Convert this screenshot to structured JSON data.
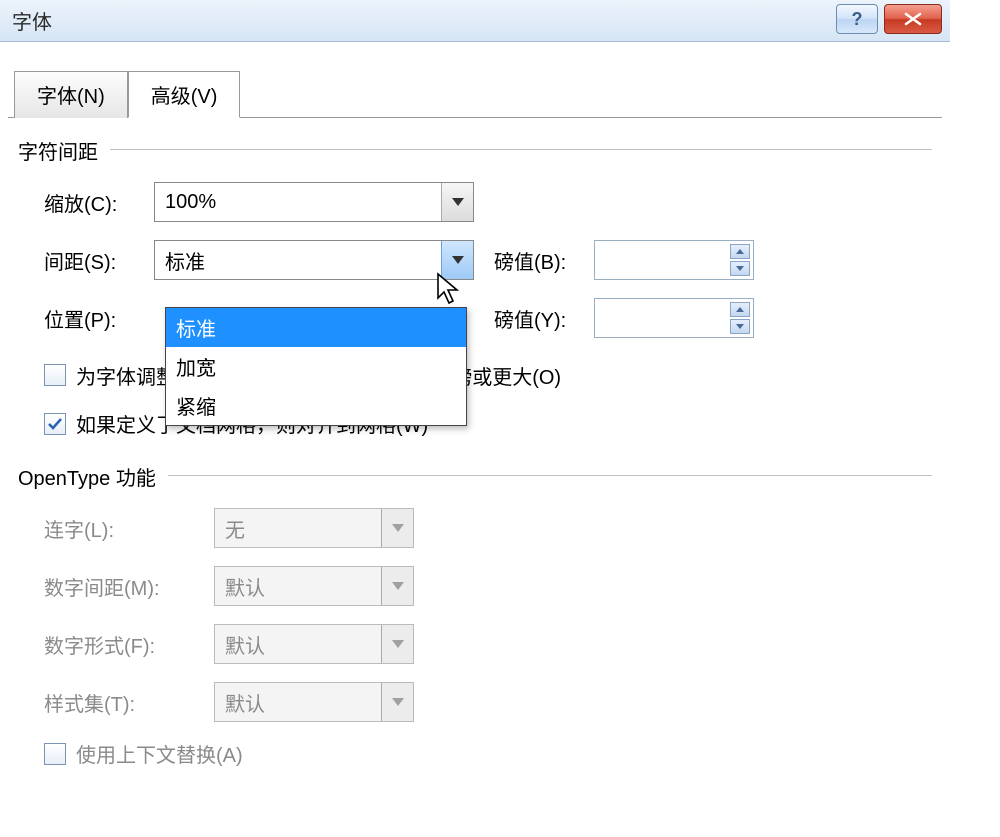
{
  "title": "字体",
  "tabs": {
    "font": "字体(N)",
    "advanced": "高级(V)"
  },
  "sections": {
    "spacing": "字符间距",
    "opentype": "OpenType 功能"
  },
  "labels": {
    "scale": "缩放(C):",
    "spacing": "间距(S):",
    "position": "位置(P):",
    "pt_b": "磅值(B):",
    "pt_y": "磅值(Y):",
    "kerning": "为字体调整字间距(K):",
    "kern_unit": "磅或更大(O)",
    "snap": "如果定义了文档网格，则对齐到网格(W)",
    "ligature": "连字(L):",
    "num_spacing": "数字间距(M):",
    "num_form": "数字形式(F):",
    "style_set": "样式集(T):",
    "context": "使用上下文替换(A)"
  },
  "values": {
    "scale": "100%",
    "spacing": "标准",
    "ligature": "无",
    "num_spacing": "默认",
    "num_form": "默认",
    "style_set": "默认"
  },
  "dropdown": {
    "items": [
      "标准",
      "加宽",
      "紧缩"
    ]
  },
  "checks": {
    "kerning": false,
    "snap": true,
    "context": false
  }
}
